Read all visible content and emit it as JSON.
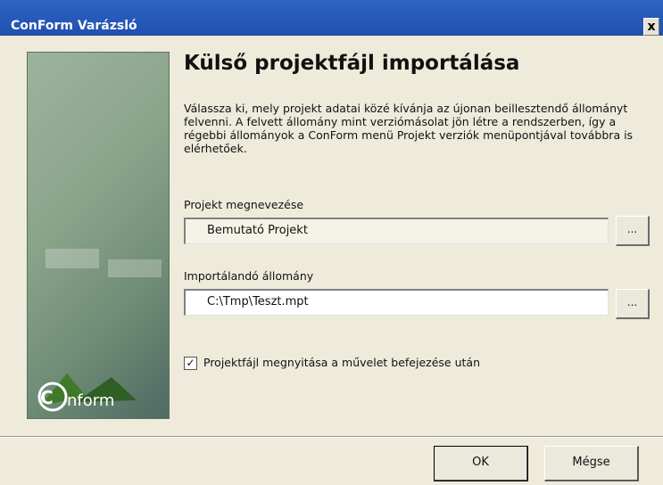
{
  "window": {
    "title": "ConForm Varázsló",
    "close_glyph": "x"
  },
  "sidebar": {
    "logo_text_left": "C",
    "logo_text_right": "nform"
  },
  "main": {
    "heading": "Külső projektfájl importálása",
    "description": "Válassza ki, mely projekt adatai közé kívánja az újonan beillesztendő állományt felvenni. A felvett állomány mint verziómásolat jön létre a rendszerben, így a régebbi állományok a ConForm menü Projekt verziók menüpontjával továbbra is elérhetőek.",
    "project_label": "Projekt megnevezése",
    "project_value": "Bemutató Projekt",
    "file_label": "Importálandó állomány",
    "file_value": "C:\\Tmp\\Teszt.mpt",
    "browse_label": "...",
    "checkbox_label": "Projektfájl megnyitása a művelet befejezése után",
    "checkbox_checked": true,
    "checkbox_mark": "✓"
  },
  "footer": {
    "ok_label": "OK",
    "cancel_label": "Mégse"
  }
}
